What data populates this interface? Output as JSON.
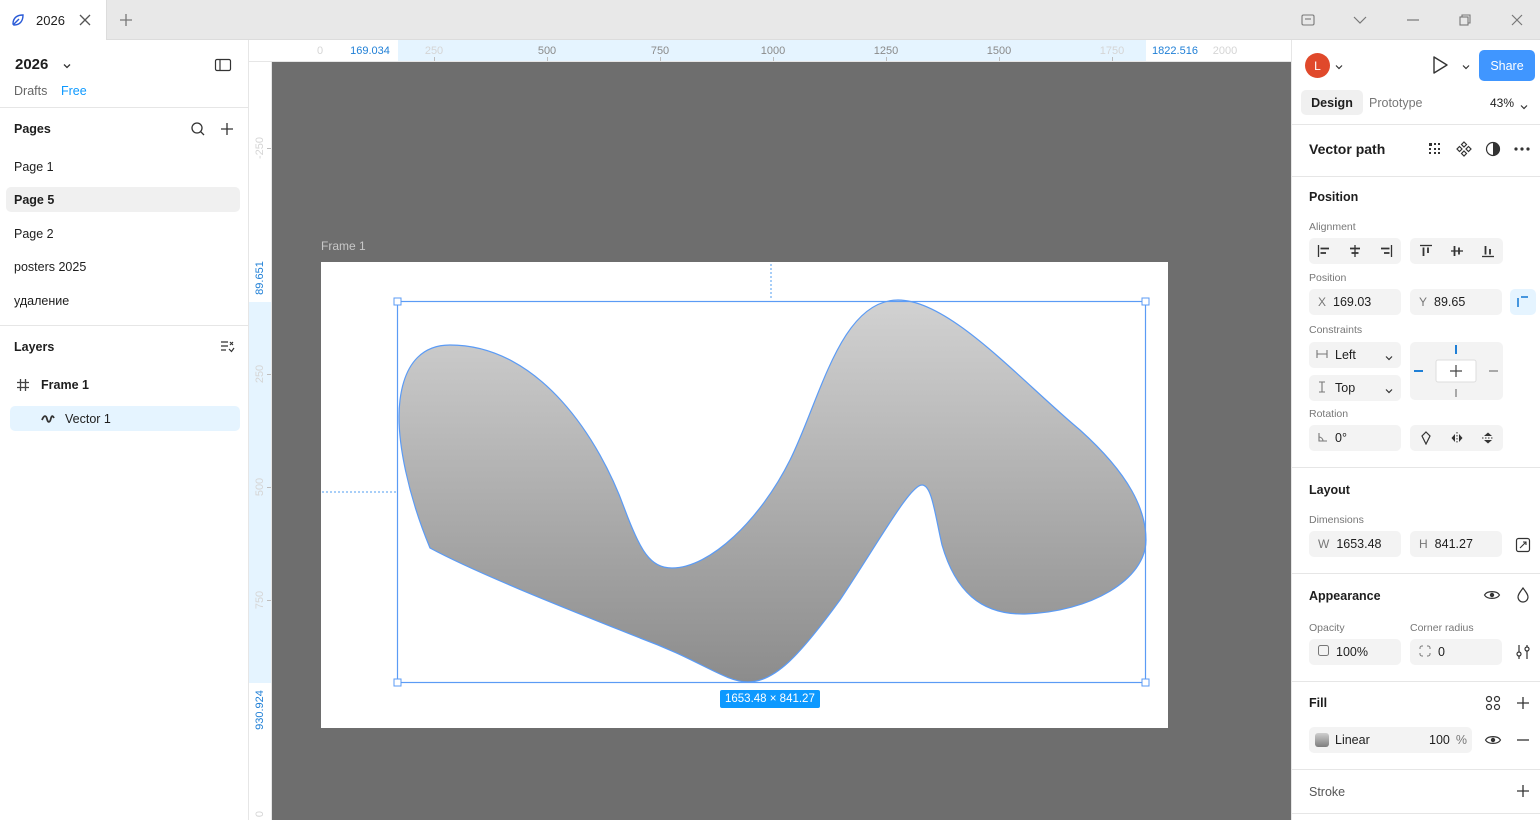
{
  "tab": {
    "title": "2026"
  },
  "file": {
    "name": "2026",
    "location": "Drafts",
    "plan": "Free"
  },
  "pages": {
    "title": "Pages",
    "items": [
      {
        "label": "Page 1",
        "active": false
      },
      {
        "label": "Page 5",
        "active": true
      },
      {
        "label": "Page 2",
        "active": false
      },
      {
        "label": "posters 2025",
        "active": false
      },
      {
        "label": "удаление",
        "active": false
      }
    ]
  },
  "layers": {
    "title": "Layers",
    "frame": "Frame 1",
    "vector": "Vector 1"
  },
  "rulers": {
    "top": [
      "0",
      "169.034",
      "250",
      "500",
      "750",
      "1000",
      "1250",
      "1500",
      "1750",
      "1822.516",
      "2000"
    ],
    "left": [
      "-250",
      "89.651",
      "250",
      "500",
      "750",
      "930.924",
      "0"
    ]
  },
  "canvas": {
    "frame_label": "Frame 1",
    "size_badge": "1653.48 × 841.27",
    "fill_gradient": [
      "#d2d2d2",
      "#8c8c8c"
    ],
    "selection_color": "#5b9bf5"
  },
  "toolbar": {
    "avatar_letter": "L",
    "avatar_color": "#e0492b",
    "share_label": "Share",
    "tabs": [
      "Design",
      "Prototype"
    ],
    "zoom": "43%"
  },
  "selection": {
    "title": "Vector path"
  },
  "position": {
    "title": "Position",
    "alignment_label": "Alignment",
    "position_label": "Position",
    "x_prefix": "X",
    "x": "169.03",
    "y_prefix": "Y",
    "y": "89.65",
    "constraints_label": "Constraints",
    "horizontal": "Left",
    "vertical": "Top",
    "rotation_label": "Rotation",
    "rotation": "0°"
  },
  "layout": {
    "title": "Layout",
    "dimensions_label": "Dimensions",
    "w_prefix": "W",
    "w": "1653.48",
    "h_prefix": "H",
    "h": "841.27"
  },
  "appearance": {
    "title": "Appearance",
    "opacity_label": "Opacity",
    "opacity": "100%",
    "radius_label": "Corner radius",
    "radius": "0"
  },
  "fill": {
    "title": "Fill",
    "type": "Linear",
    "opacity": "100",
    "unit": "%"
  },
  "stroke": {
    "title": "Stroke"
  }
}
